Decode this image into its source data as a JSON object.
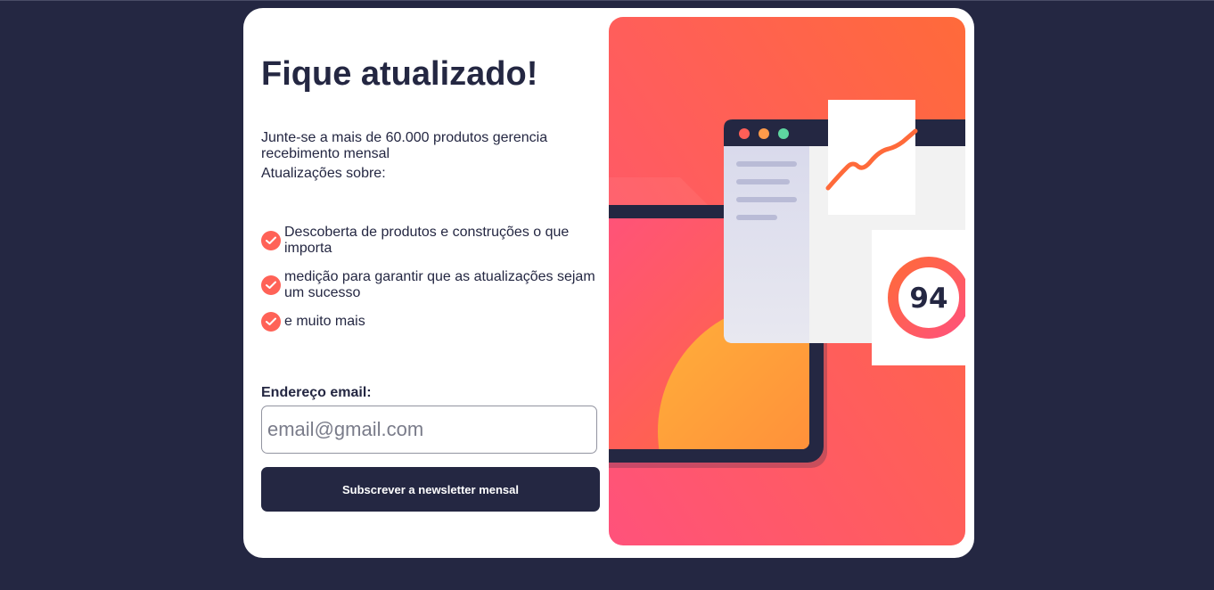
{
  "signup": {
    "title": "Fique atualizado!",
    "intro": "Junte-se a mais de 60.000 produtos gerencia recebimento mensal",
    "updates_label": "Atualizações sobre:",
    "features": [
      "Descoberta de produtos e construções o que importa",
      "medição para garantir que as atualizações sejam um sucesso",
      "e muito mais"
    ],
    "email_label": "Endereço email:",
    "email_placeholder": "email@gmail.com",
    "submit_label": "Subscrever a newsletter mensal"
  },
  "illustration": {
    "score": "94"
  },
  "colors": {
    "background": "#242742",
    "accent": "#ff6257",
    "card": "#ffffff",
    "text": "#242742"
  },
  "icons": {
    "check": "check-circle-icon",
    "window_dots": "window-dots-icon"
  }
}
